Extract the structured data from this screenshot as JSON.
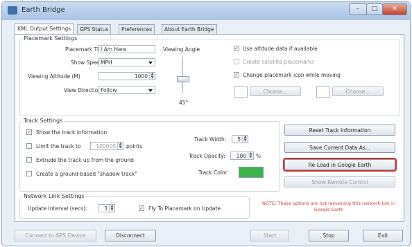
{
  "window": {
    "title": "Earth Bridge",
    "controls": {
      "minimize": "–",
      "maximize": "□",
      "close": "✕"
    },
    "icon": "globe-icon"
  },
  "tabs": [
    {
      "label": "KML Output Settings",
      "active": true
    },
    {
      "label": "GPS Status",
      "active": false
    },
    {
      "label": "Preferences",
      "active": false
    },
    {
      "label": "About Earth Bridge",
      "active": false
    }
  ],
  "placemark": {
    "group_label": "Placemark Settings",
    "title_label": "Placemark Title",
    "title_value": "I Am Here",
    "speed_label": "Show Speed",
    "speed_value": "MPH",
    "altitude_label": "Viewing Altitude (M)",
    "altitude_value": "1000",
    "direction_label": "View Direction",
    "direction_value": "Follow",
    "angle_label": "Viewing Angle",
    "angle_value": "45°",
    "use_altitude_label": "Use altitude data if available",
    "use_altitude_checked": true,
    "create_satellite_label": "Create satellite placemarks",
    "create_satellite_checked": false,
    "change_icon_label": "Change placemark icon while moving",
    "change_icon_checked": true,
    "choose1_label": "Choose...",
    "choose2_label": "Choose..."
  },
  "track": {
    "group_label": "Track Settings",
    "show_track_label": "Show the track information",
    "show_track_checked": true,
    "limit_track_label": "Limit the track to",
    "limit_track_value": "100000",
    "limit_track_suffix": "points",
    "limit_track_checked": false,
    "extrude_label": "Extrude the track up from the ground",
    "extrude_checked": false,
    "shadow_label": "Create a ground-based \"shadow track\"",
    "shadow_checked": false,
    "width_label": "Track Width:",
    "width_value": "5",
    "opacity_label": "Track Opacity:",
    "opacity_value": "100",
    "opacity_suffix": "%",
    "color_label": "Track Color:",
    "color_hex": "#3cb44b"
  },
  "actions": {
    "reset_label": "Reset Track Information",
    "save_label": "Save Current Data As...",
    "reload_label": "Re-Load in Google Earth",
    "remote_label": "Show Remote Control"
  },
  "network": {
    "group_label": "Network Link Settings",
    "interval_label": "Update Interval (secs):",
    "interval_value": "3",
    "fly_label": "Fly To Placemark on Update",
    "fly_checked": true,
    "note": "NOTE: These options are not remaining this network link in Google Earth"
  },
  "footer": {
    "connect_label": "Connect to GPS Device",
    "disconnect_label": "Disconnect",
    "start_label": "Start",
    "stop_label": "Stop",
    "exit_label": "Exit"
  },
  "colors": {
    "highlight": "#d0322a",
    "note": "#d03a3a",
    "track": "#3cb44b"
  }
}
